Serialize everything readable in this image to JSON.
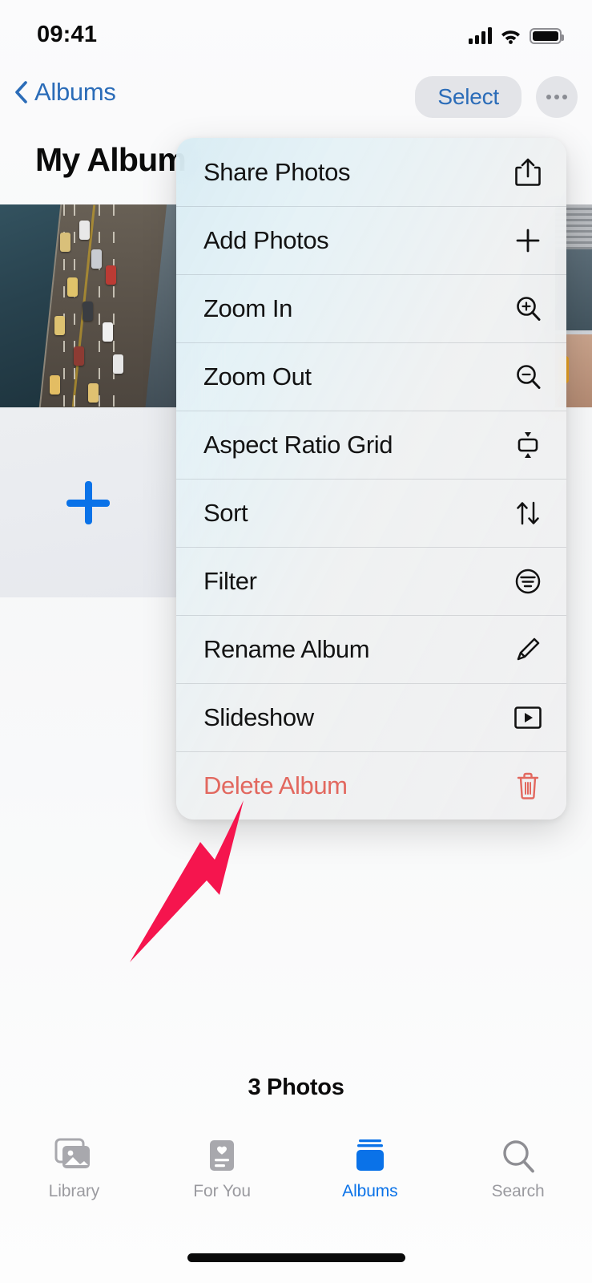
{
  "status_bar": {
    "time": "09:41",
    "cellular_icon": "cellular-bars-icon",
    "wifi_icon": "wifi-icon",
    "battery_icon": "battery-full-icon"
  },
  "nav_bar": {
    "back_icon": "chevron-left-icon",
    "back_label": "Albums",
    "select_label": "Select",
    "more_icon": "ellipsis-icon"
  },
  "page": {
    "album_title": "My Album",
    "photo_count": "3 Photos",
    "add_photo_icon": "plus-icon"
  },
  "context_menu": {
    "items": [
      {
        "label": "Share Photos",
        "icon": "share-icon",
        "destructive": false
      },
      {
        "label": "Add Photos",
        "icon": "plus-icon",
        "destructive": false
      },
      {
        "label": "Zoom In",
        "icon": "zoom-in-icon",
        "destructive": false
      },
      {
        "label": "Zoom Out",
        "icon": "zoom-out-icon",
        "destructive": false
      },
      {
        "label": "Aspect Ratio Grid",
        "icon": "aspect-ratio-icon",
        "destructive": false
      },
      {
        "label": "Sort",
        "icon": "sort-arrows-icon",
        "destructive": false
      },
      {
        "label": "Filter",
        "icon": "filter-icon",
        "destructive": false
      },
      {
        "label": "Rename Album",
        "icon": "pencil-icon",
        "destructive": false
      },
      {
        "label": "Slideshow",
        "icon": "play-box-icon",
        "destructive": false
      },
      {
        "label": "Delete Album",
        "icon": "trash-icon",
        "destructive": true
      }
    ]
  },
  "annotation": {
    "arrow_icon": "pointer-arrow-icon",
    "arrow_color": "#F5154E",
    "points_at": "Delete Album"
  },
  "tab_bar": {
    "tabs": [
      {
        "label": "Library",
        "icon": "photo-stack-icon",
        "active": false
      },
      {
        "label": "For You",
        "icon": "for-you-card-icon",
        "active": false
      },
      {
        "label": "Albums",
        "icon": "albums-stack-icon",
        "active": true
      },
      {
        "label": "Search",
        "icon": "magnifier-icon",
        "active": false
      }
    ]
  },
  "colors": {
    "accent_blue": "#0A72E8",
    "nav_blue": "#2B6CB8",
    "destructive_red": "#E2685F",
    "annotation_pink": "#F5154E",
    "inactive_gray": "#9A9A9F"
  }
}
